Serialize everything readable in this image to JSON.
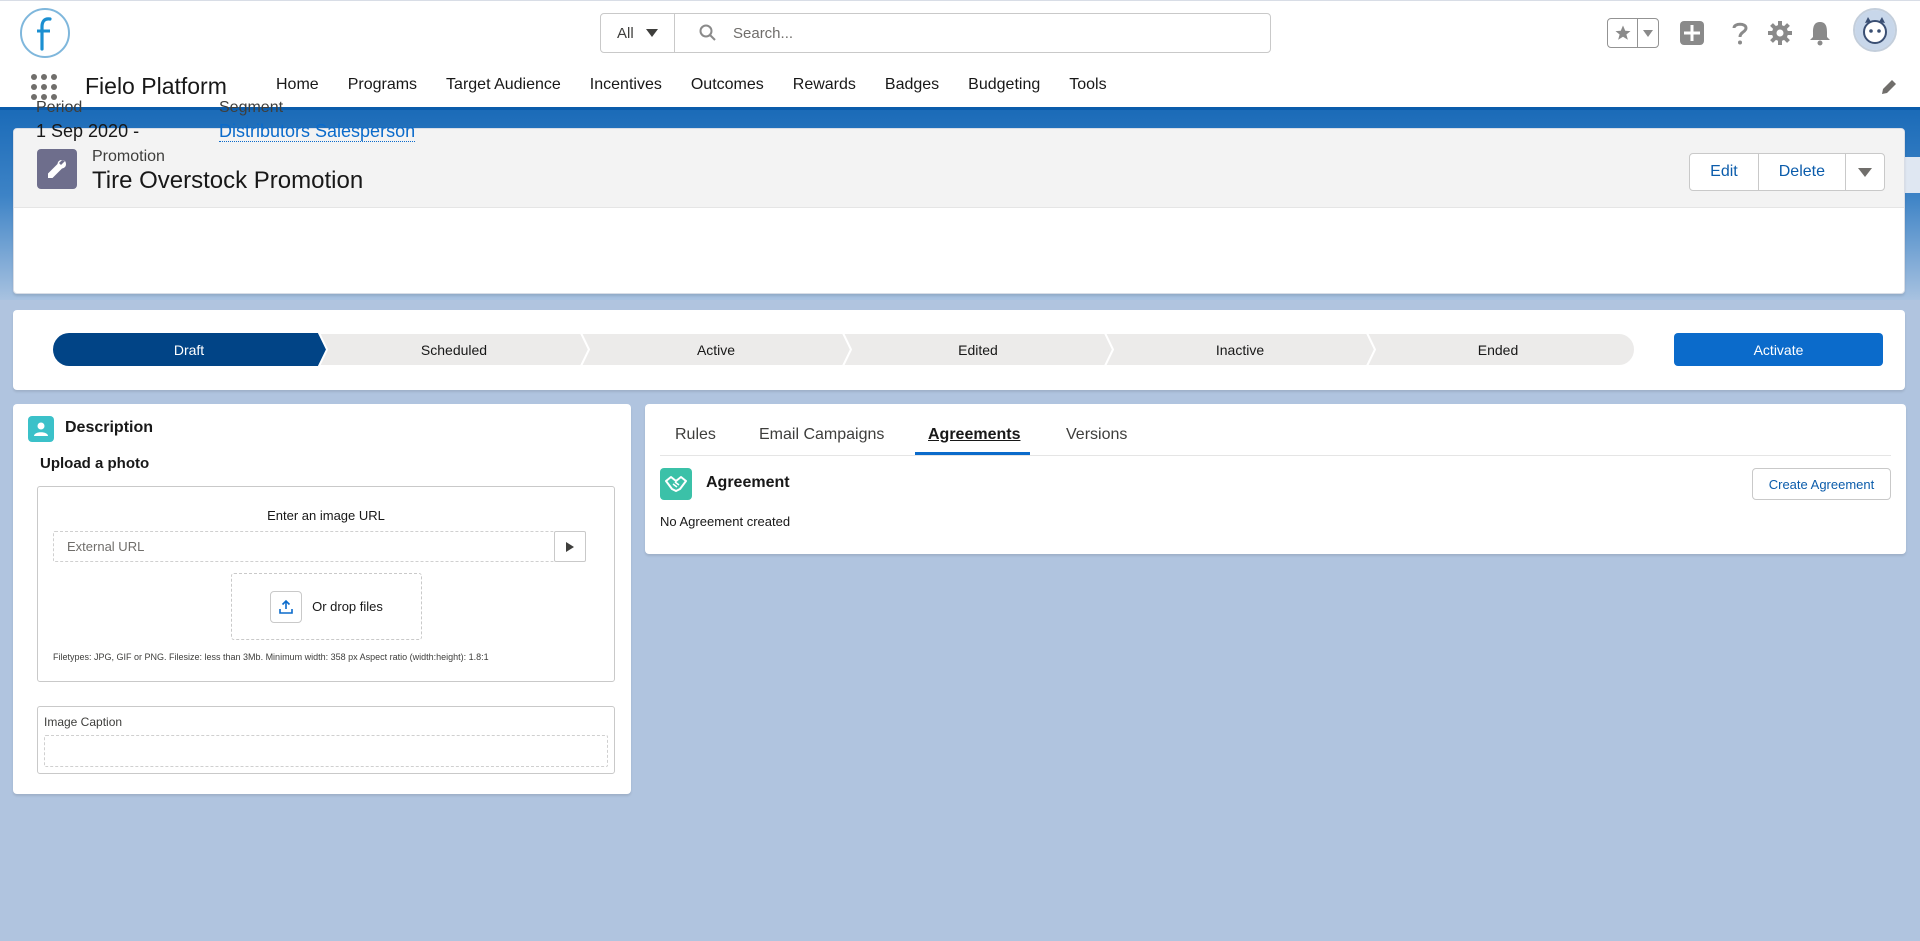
{
  "global_header": {
    "search_scope": "All",
    "search_placeholder": "Search..."
  },
  "nav": {
    "app_name": "Fielo Platform",
    "items": [
      "Home",
      "Programs",
      "Target Audience",
      "Incentives",
      "Outcomes",
      "Rewards",
      "Badges",
      "Budgeting",
      "Tools"
    ]
  },
  "record": {
    "type": "Promotion",
    "title": "Tire Overstock Promotion",
    "actions": {
      "edit": "Edit",
      "delete": "Delete"
    },
    "fields": [
      {
        "label": "Period",
        "value": "1 Sep 2020 -"
      },
      {
        "label": "Segment",
        "value": "Distributors Salesperson"
      }
    ]
  },
  "path": {
    "stages": [
      "Draft",
      "Scheduled",
      "Active",
      "Edited",
      "Inactive",
      "Ended"
    ],
    "current_stage": "Draft",
    "action_label": "Activate",
    "colors": {
      "current": "#014486",
      "inactive": "#ecebea",
      "action": "#0b6bcb"
    }
  },
  "description": {
    "title": "Description",
    "upload_title": "Upload a photo",
    "image_url_label": "Enter an image URL",
    "url_placeholder": "External URL",
    "drop_label": "Or drop files",
    "filetypes_note": "Filetypes: JPG, GIF or PNG. Filesize: less than 3Mb. Minimum width: 358 px Aspect ratio (width:height): 1.8:1",
    "caption_label": "Image Caption"
  },
  "tabs": {
    "items": [
      "Rules",
      "Email Campaigns",
      "Agreements",
      "Versions"
    ],
    "active": "Agreements"
  },
  "agreement": {
    "title": "Agreement",
    "create_label": "Create Agreement",
    "empty_text": "No Agreement created"
  }
}
